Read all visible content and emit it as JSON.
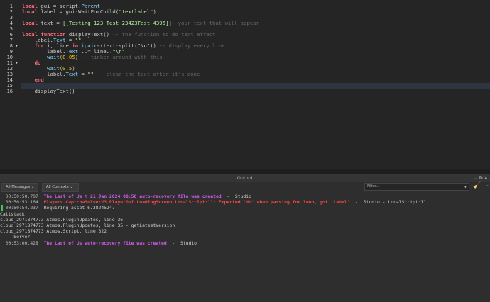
{
  "editor": {
    "current_line": 15,
    "folds": [
      8,
      11
    ],
    "lines": [
      [
        [
          "local ",
          "kw"
        ],
        [
          "gui = script.",
          "pl"
        ],
        [
          "Parent",
          "bi"
        ]
      ],
      [
        [
          "local ",
          "kw"
        ],
        [
          "label = gui:WaitForChild(",
          "pl"
        ],
        [
          "\"textlabel\"",
          "st"
        ],
        [
          ")",
          "pl"
        ]
      ],
      [],
      [
        [
          "local ",
          "kw"
        ],
        [
          "text = ",
          "pl"
        ],
        [
          "[[Testing 123 Test 23423Test 4395]]",
          "st"
        ],
        [
          "--your text that will appear",
          "cm"
        ]
      ],
      [],
      [
        [
          "local function ",
          "kw"
        ],
        [
          "displayText() ",
          "pl"
        ],
        [
          "-- the function to do text effect",
          "cm"
        ]
      ],
      [
        [
          "    label.",
          "pl"
        ],
        [
          "Text",
          "bi"
        ],
        [
          " = ",
          "pl"
        ],
        [
          "\"\"",
          "st"
        ]
      ],
      [
        [
          "    ",
          "pl"
        ],
        [
          "for ",
          "kw"
        ],
        [
          "i, line ",
          "pl"
        ],
        [
          "in ",
          "kw"
        ],
        [
          "ipairs",
          "bi"
        ],
        [
          "(text:split(",
          "pl"
        ],
        [
          "\"\\n\"",
          "st"
        ],
        [
          ")) ",
          "pl"
        ],
        [
          "-- display every line",
          "cm"
        ]
      ],
      [
        [
          "        label.",
          "pl"
        ],
        [
          "Text",
          "bi"
        ],
        [
          " ..= line..",
          "pl"
        ],
        [
          "\"\\n\"",
          "st"
        ]
      ],
      [
        [
          "        ",
          "pl"
        ],
        [
          "wait",
          "bi"
        ],
        [
          "(",
          "pl"
        ],
        [
          "0.05",
          "nu"
        ],
        [
          ") ",
          "pl"
        ],
        [
          "-- tinker around with this",
          "cm"
        ]
      ],
      [
        [
          "    ",
          "pl"
        ],
        [
          "do",
          "kw"
        ]
      ],
      [
        [
          "        ",
          "pl"
        ],
        [
          "wait",
          "bi"
        ],
        [
          "(",
          "pl"
        ],
        [
          "0.5",
          "nu"
        ],
        [
          ")",
          "pl"
        ]
      ],
      [
        [
          "        label.",
          "pl"
        ],
        [
          "Text",
          "bi"
        ],
        [
          " = ",
          "pl"
        ],
        [
          "\"\"",
          "st"
        ],
        [
          " -- clear the text after it's done",
          "cm"
        ]
      ],
      [
        [
          "    ",
          "pl"
        ],
        [
          "end",
          "kw"
        ]
      ],
      [],
      [
        [
          "    displayText()",
          "pl"
        ]
      ]
    ]
  },
  "output": {
    "title": "Output",
    "controls": "⌄ ⧉ ✕",
    "messages_filter": "All Messages",
    "contexts_filter": "All Contexts",
    "filter_placeholder": "Filter...",
    "log": [
      {
        "time": "00:50:50.707",
        "text": "The Last of Us @ 21 Jan 2024 00:50 auto-recovery file was created",
        "kind": "p",
        "suffix": "  -  Studio"
      },
      {
        "time": "00:50:53.164",
        "text": "Players.CaptchaSolverV3.PlayerGui.LoadingScreen.LocalScript:11: Expected 'do' when parsing for loop, got 'label'",
        "kind": "e",
        "suffix": "  -  Studio - LocalScript:11"
      },
      {
        "time": "00:50:54.237",
        "text": "Requiring asset 6738245247.",
        "kind": "n",
        "suffix": "",
        "mark": true
      },
      {
        "raw": "Callstack:"
      },
      {
        "raw": "cloud_2971874773.Atmos.PluginUpdates, line 36"
      },
      {
        "raw": "cloud_2971874773.Atmos.PluginUpdates, line 35 - getLatestVersion"
      },
      {
        "raw": "cloud_2971874773.Atmos.Script, line 322"
      },
      {
        "raw": "  -  Server"
      },
      {
        "time": "00:53:00.428",
        "text": "The Last of Us auto-recovery file was created",
        "kind": "p",
        "suffix": "  -  Studio"
      }
    ]
  }
}
